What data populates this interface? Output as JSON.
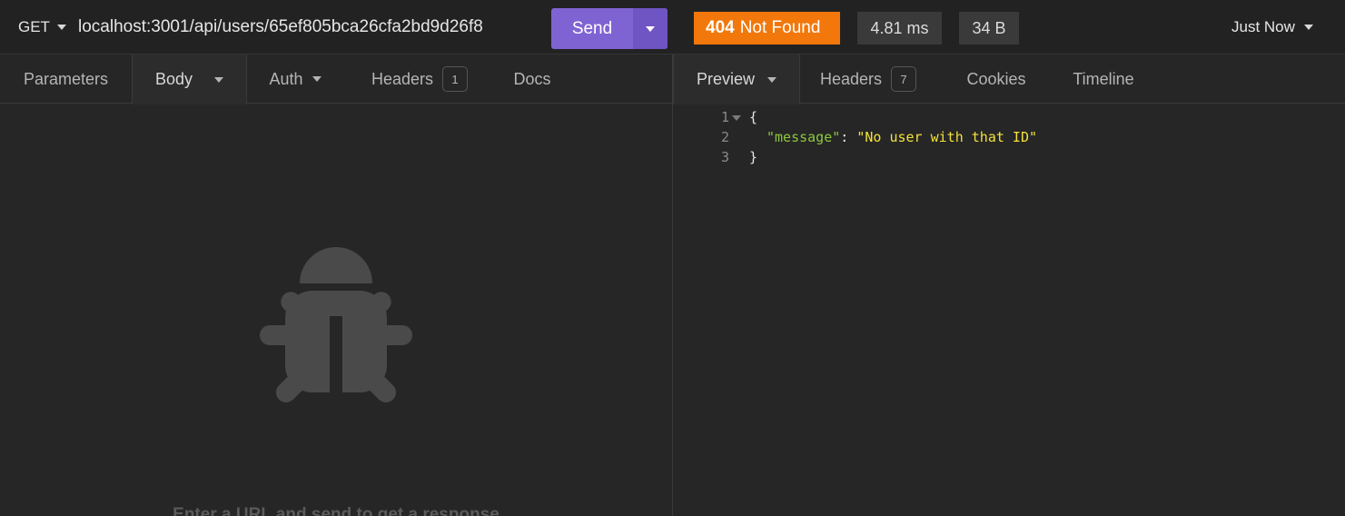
{
  "request": {
    "method": "GET",
    "url": "localhost:3001/api/users/65ef805bca26cfa2bd9d26f8",
    "send_label": "Send"
  },
  "response_meta": {
    "status_code": "404",
    "status_text": "Not Found",
    "time": "4.81 ms",
    "size": "34 B",
    "history_label": "Just Now"
  },
  "request_tabs": [
    {
      "label": "Parameters"
    },
    {
      "label": "Body"
    },
    {
      "label": "Auth"
    },
    {
      "label": "Headers",
      "count": "1"
    },
    {
      "label": "Docs"
    }
  ],
  "response_tabs": [
    {
      "label": "Preview"
    },
    {
      "label": "Headers",
      "count": "7"
    },
    {
      "label": "Cookies"
    },
    {
      "label": "Timeline"
    }
  ],
  "empty_state": {
    "icon": "bug-icon",
    "hint": "Enter a URL and send to get a response"
  },
  "response_body": {
    "lines": [
      {
        "number": "1",
        "open": "{"
      },
      {
        "number": "2",
        "key": "\"message\"",
        "sep": ": ",
        "value": "\"No user with that ID\""
      },
      {
        "number": "3",
        "close": "}"
      }
    ]
  },
  "colors": {
    "background": "#262626",
    "send_button": "#7f63d2",
    "status_404": "#f2780b",
    "json_key": "#8cc83c",
    "json_string": "#f3e03a"
  }
}
